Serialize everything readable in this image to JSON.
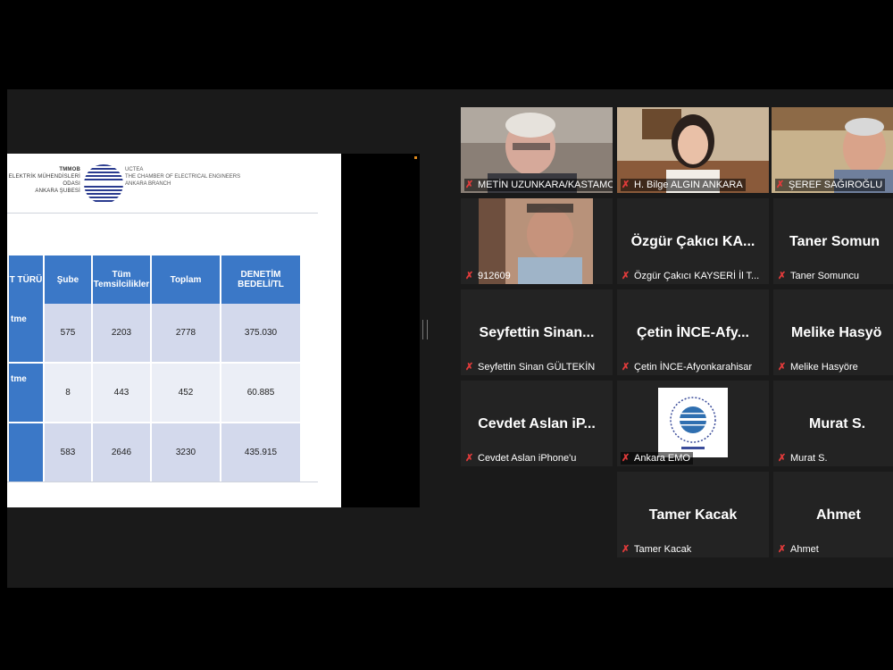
{
  "slide": {
    "logo_left": [
      "TMMOB",
      "ELEKTRİK MÜHENDİSLERİ ODASI",
      "ANKARA ŞUBESİ"
    ],
    "logo_right": [
      "UCTEA",
      "THE CHAMBER OF ELECTRICAL ENGINEERS",
      "ANKARA BRANCH"
    ],
    "table": {
      "headers": [
        "T TÜRÜ",
        "Şube",
        "Tüm Temsilcilikler",
        "Toplam",
        "DENETİM BEDELİ/TL"
      ],
      "rows": [
        {
          "label": "tme",
          "cells": [
            "575",
            "2203",
            "2778",
            "375.030"
          ]
        },
        {
          "label": "tme",
          "cells": [
            "8",
            "443",
            "452",
            "60.885"
          ]
        },
        {
          "label": "",
          "cells": [
            "583",
            "2646",
            "3230",
            "435.915"
          ]
        }
      ]
    }
  },
  "participants": [
    {
      "big": "",
      "name": "METİN UZUNKARA/KASTAMONU",
      "video": true
    },
    {
      "big": "",
      "name": "H. Bilge ALGIN ANKARA",
      "video": true
    },
    {
      "big": "",
      "name": "ŞEREF SAĞIROĞLU",
      "video": true
    },
    {
      "big": "",
      "name": "912609",
      "video": true
    },
    {
      "big": "Özgür Çakıcı KA...",
      "name": "Özgür Çakıcı KAYSERİ İl T...",
      "video": false
    },
    {
      "big": "Taner Somun",
      "name": "Taner Somuncu",
      "video": false
    },
    {
      "big": "Seyfettin Sinan...",
      "name": "Seyfettin Sinan GÜLTEKİN",
      "video": false
    },
    {
      "big": "Çetin İNCE-Afy...",
      "name": "Çetin İNCE-Afyonkarahisar",
      "video": false
    },
    {
      "big": "Melike Hasyö",
      "name": "Melike Hasyöre",
      "video": false
    },
    {
      "big": "Cevdet Aslan iP...",
      "name": "Cevdet Aslan iPhone'u",
      "video": false
    },
    {
      "big": "",
      "name": "Ankara EMO",
      "video": false
    },
    {
      "big": "Murat S.",
      "name": "Murat S.",
      "video": false
    },
    {
      "big": "Tamer Kacak",
      "name": "Tamer Kacak",
      "video": false
    },
    {
      "big": "Ahmet",
      "name": "Ahmet",
      "video": false
    }
  ],
  "colors": {
    "accent": "#3b78c7",
    "active_speaker": "#d6e649",
    "muted": "#e23b3b"
  },
  "icons": {
    "mic_muted": "microphone-muted-icon"
  }
}
